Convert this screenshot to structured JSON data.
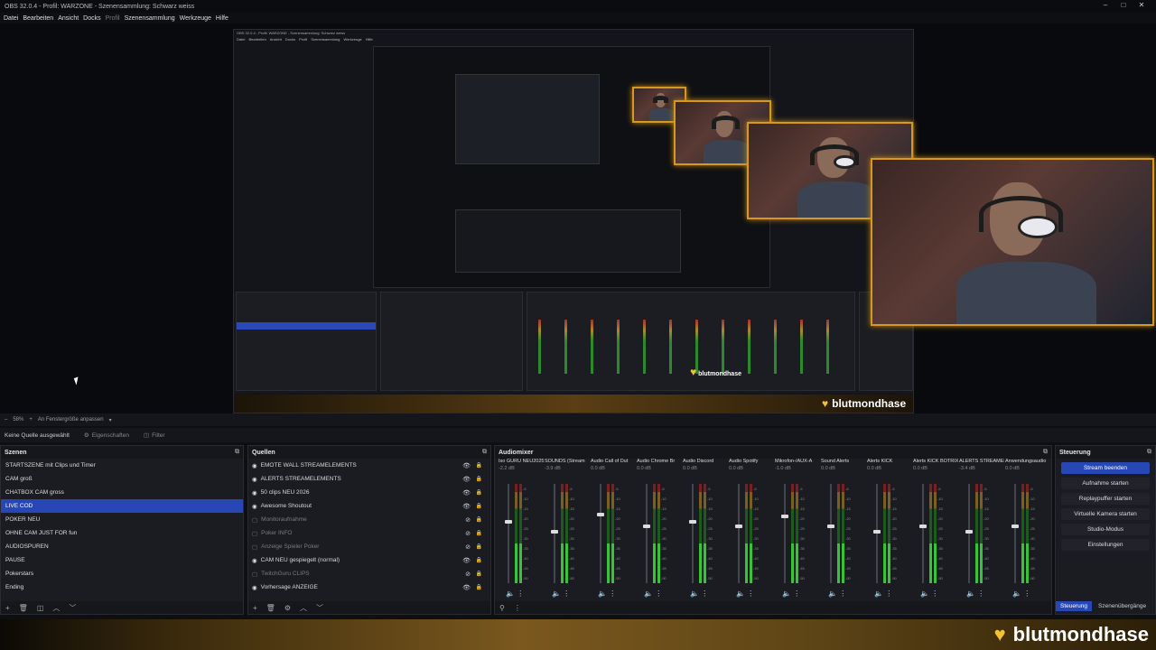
{
  "window": {
    "title": "OBS 32.0.4 - Profil: WARZONE - Szenensammlung: Schwarz weiss"
  },
  "menu": [
    {
      "label": "Datei",
      "dim": false
    },
    {
      "label": "Bearbeiten",
      "dim": false
    },
    {
      "label": "Ansicht",
      "dim": false
    },
    {
      "label": "Docks",
      "dim": false
    },
    {
      "label": "Profil",
      "dim": true
    },
    {
      "label": "Szenensammlung",
      "dim": false
    },
    {
      "label": "Werkzeuge",
      "dim": false
    },
    {
      "label": "Hilfe",
      "dim": false
    }
  ],
  "preview": {
    "overlay_name": "blutmondhase",
    "embedded_title": "OBS 32.0.4 - Profil: WARZONE - Szenensammlung: Schwarz weiss",
    "embedded_menu": "Datei Bearbeiten Ansicht Docks Profil Szenensammlung Werkzeuge Hilfe"
  },
  "zoom": {
    "value": "58%",
    "fit_label": "An Fenstergröße anpassen"
  },
  "source_bar": {
    "status": "Keine Quelle ausgewählt",
    "properties": "Eigenschaften",
    "filter": "Filter"
  },
  "scenes": {
    "title": "Szenen",
    "selected_index": 3,
    "items": [
      "STARTSZENE mit Clips und Timer",
      "CAM groß",
      "CHATBOX CAM gross",
      "LIVE COD",
      "POKER NEU",
      "OHNE CAM JUST FOR fun",
      "AUDIOSPUREN",
      "PAUSE",
      "Pokerstars",
      "Ending"
    ]
  },
  "sources": {
    "title": "Quellen",
    "items": [
      {
        "label": "EMOTE WALL STREAMELEMENTS",
        "visible": true
      },
      {
        "label": "ALERTS STREAMELEMENTS",
        "visible": true
      },
      {
        "label": "50 clips NEU 2026",
        "visible": true
      },
      {
        "label": "Awesome Shoutout",
        "visible": true
      },
      {
        "label": "Monitoraufnahme",
        "visible": false
      },
      {
        "label": "Poker INFO",
        "visible": false
      },
      {
        "label": "Anzeige Spieler Poker",
        "visible": false
      },
      {
        "label": "CAM NEU gespiegelt (normal)",
        "visible": true
      },
      {
        "label": "TwitchGuru CLIPS",
        "visible": false
      },
      {
        "label": "Vorhersage ANZEIGE",
        "visible": true
      }
    ]
  },
  "mixer": {
    "title": "Audiomixer",
    "channels": [
      {
        "name": "Iso GURU NEU2025",
        "db": "-2.2 dB",
        "level": 0.55,
        "active": true
      },
      {
        "name": "SOUNDS (Stream",
        "db": "-3.9 dB",
        "level": 0.45,
        "active": true
      },
      {
        "name": "Audio Call of Dut",
        "db": "0.0 dB",
        "level": 0.62,
        "active": true
      },
      {
        "name": "Audio Chrome Br",
        "db": "0.0 dB",
        "level": 0.5,
        "active": true
      },
      {
        "name": "Audio Discord",
        "db": "0.0 dB",
        "level": 0.55,
        "active": true
      },
      {
        "name": "Audio Spotify",
        "db": "0.0 dB",
        "level": 0.5,
        "active": true
      },
      {
        "name": "Mikrofon-/AUX-A",
        "db": "-1.0 dB",
        "level": 0.6,
        "active": true
      },
      {
        "name": "Sound Alerts",
        "db": "0.0 dB",
        "level": 0.5,
        "active": true
      },
      {
        "name": "Alerts KICK",
        "db": "0.0 dB",
        "level": 0.45,
        "active": true
      },
      {
        "name": "Alerts KICK BOTRIX",
        "db": "0.0 dB",
        "level": 0.5,
        "active": true
      },
      {
        "name": "ALERTS STREAMELE",
        "db": "-3.4 dB",
        "level": 0.45,
        "active": true
      },
      {
        "name": "Anwendungsaudio",
        "db": "0.0 dB",
        "level": 0.5,
        "active": true
      }
    ]
  },
  "controls": {
    "title": "Steuerung",
    "buttons": [
      "Stream beenden",
      "Aufnahme starten",
      "Replaypuffer starten",
      "Virtuelle Kamera starten",
      "Studio-Modus",
      "Einstellungen"
    ],
    "tabs": [
      "Steuerung",
      "Szenenübergänge"
    ]
  },
  "stream_overlay": {
    "name": "blutmondhase"
  },
  "colors": {
    "accent": "#2747b5",
    "gold": "#d59a1d"
  }
}
